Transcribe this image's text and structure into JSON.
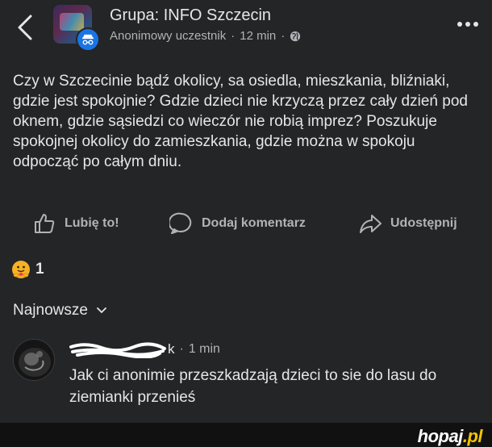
{
  "header": {
    "group_title": "Grupa: INFO Szczecin",
    "author": "Anonimowy uczestnik",
    "separator": "·",
    "time": "12 min",
    "privacy_icon": "globe-icon",
    "back_icon": "chevron-left-icon",
    "more_icon": "more-dots-icon"
  },
  "post": {
    "text": "Czy w Szczecinie bądź okolicy, sa osiedla, mieszkania, bliźniaki, gdzie jest spokojnie? Gdzie dzieci nie krzyczą przez cały dzień pod oknem, gdzie sąsiedzi co wieczór nie robią imprez? Poszukuje spokojnej okolicy do zamieszkania, gdzie można w spokoju odpocząć po całym dniu."
  },
  "actions": {
    "like": "Lubię to!",
    "comment": "Dodaj komentarz",
    "share": "Udostępnij"
  },
  "reactions": {
    "emoji": "care-reaction-icon",
    "count": "1"
  },
  "comments": {
    "sort_label": "Najnowsze",
    "items": [
      {
        "author_visible_suffix": "k",
        "separator": "·",
        "time": "1 min",
        "text": "Jak ci anonimie przeszkadzają dzieci to sie do lasu do ziemianki przenieś"
      }
    ]
  },
  "watermark": {
    "brand": "hopaj",
    "tld": ".pl"
  },
  "colors": {
    "background": "#242526",
    "text": "#e4e6eb",
    "secondary_text": "#b0b3b8",
    "anon_badge": "#1b74e4",
    "watermark_accent": "#f5c400"
  }
}
